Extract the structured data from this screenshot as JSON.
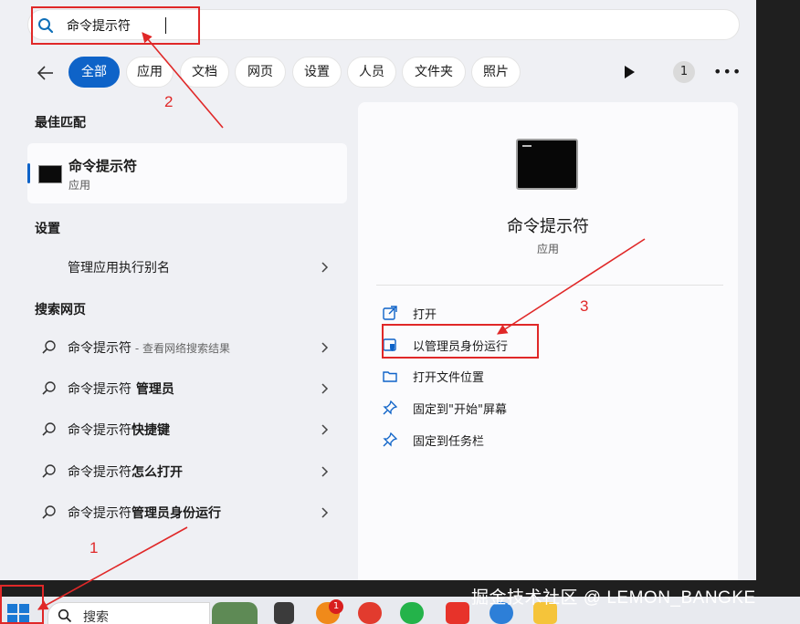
{
  "search": {
    "query": "命令提示符"
  },
  "filters": [
    {
      "label": "全部",
      "active": true
    },
    {
      "label": "应用"
    },
    {
      "label": "文档"
    },
    {
      "label": "网页"
    },
    {
      "label": "设置"
    },
    {
      "label": "人员"
    },
    {
      "label": "文件夹"
    },
    {
      "label": "照片"
    }
  ],
  "filter_count": "1",
  "sections": {
    "best_match": "最佳匹配",
    "settings": "设置",
    "web": "搜索网页"
  },
  "best_match": {
    "name": "命令提示符",
    "type": "应用"
  },
  "settings_items": [
    {
      "label": "管理应用执行别名"
    }
  ],
  "web_items": [
    {
      "prefix": "命令提示符",
      "sub": " - 查看网络搜索结果"
    },
    {
      "prefix": "命令提示符",
      "bold": " 管理员"
    },
    {
      "prefix": "命令提示符",
      "bold": "快捷键"
    },
    {
      "prefix": "命令提示符",
      "bold": "怎么打开"
    },
    {
      "prefix": "命令提示符",
      "bold": "管理员身份运行"
    }
  ],
  "preview": {
    "name": "命令提示符",
    "type": "应用",
    "actions": [
      {
        "label": "打开",
        "icon": "open-icon"
      },
      {
        "label": "以管理员身份运行",
        "icon": "shield-icon"
      },
      {
        "label": "打开文件位置",
        "icon": "folder-icon"
      },
      {
        "label": "固定到\"开始\"屏幕",
        "icon": "pin-icon"
      },
      {
        "label": "固定到任务栏",
        "icon": "pin-icon"
      }
    ]
  },
  "annotations": {
    "one": "1",
    "two": "2",
    "three": "3"
  },
  "taskbar": {
    "search_label": "搜索",
    "notification_count": "1"
  },
  "watermark": "掘金技术社区 @ LEMON_BANGKE",
  "colors": {
    "accent": "#0e63c8",
    "annotation": "#e02828"
  }
}
